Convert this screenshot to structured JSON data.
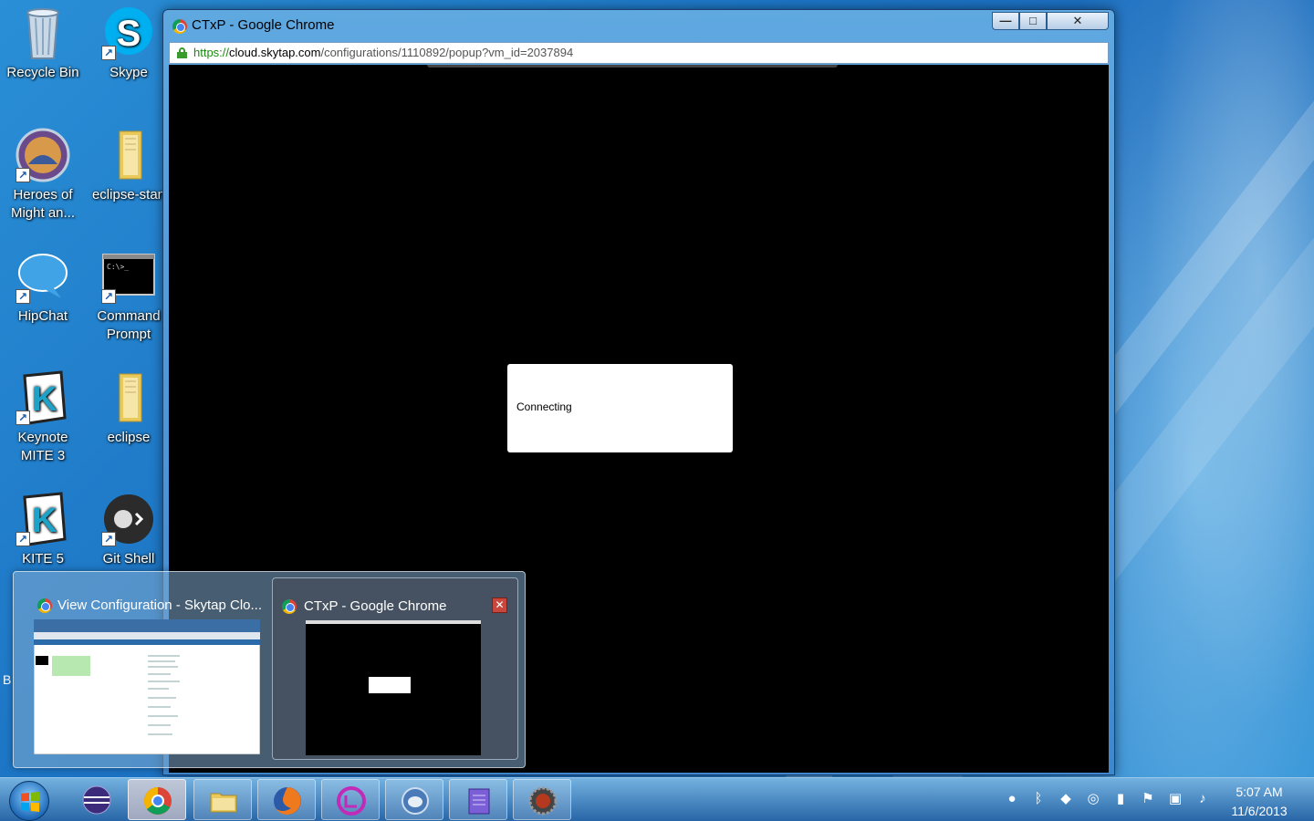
{
  "desktop": {
    "icons": [
      {
        "label": "Recycle Bin"
      },
      {
        "label": "Skype"
      },
      {
        "label": "Heroes of Might an..."
      },
      {
        "label": "eclipse-stan"
      },
      {
        "label": "HipChat"
      },
      {
        "label": "Command Prompt"
      },
      {
        "label": "Keynote MITE 3"
      },
      {
        "label": "eclipse"
      },
      {
        "label": "KITE 5"
      },
      {
        "label": "Git Shell"
      }
    ],
    "partial_text": "B"
  },
  "window": {
    "title": "CTxP - Google Chrome",
    "url_scheme": "https://",
    "url_host": "cloud.skytap.com",
    "url_path": "/configurations/1110892/popup?vm_id=2037894",
    "controls": {
      "minimize": "—",
      "maximize": "□",
      "close": "✕"
    }
  },
  "content": {
    "dialog_text": "Connecting"
  },
  "thumbnails": [
    {
      "title": "View Configuration - Skytap Clo..."
    },
    {
      "title": "CTxP - Google Chrome",
      "close": "✕"
    }
  ],
  "taskbar": {
    "apps": [
      {
        "icon": "eclipse-icon"
      },
      {
        "icon": "chrome-icon"
      },
      {
        "icon": "folder-icon"
      },
      {
        "icon": "firefox-icon"
      },
      {
        "icon": "app-icon"
      },
      {
        "icon": "chat-icon"
      },
      {
        "icon": "notepad-icon"
      },
      {
        "icon": "java-ee-ide-icon"
      }
    ],
    "time": "5:07 AM",
    "date": "11/6/2013"
  }
}
